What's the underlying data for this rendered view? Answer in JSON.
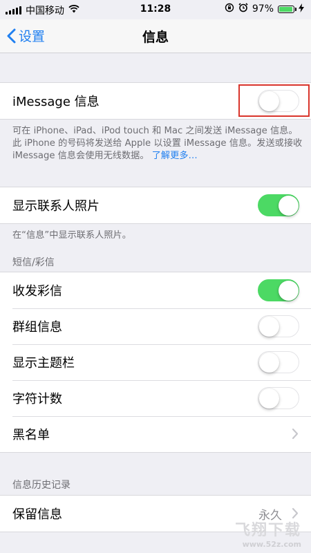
{
  "status_bar": {
    "carrier": "中国移动",
    "time": "11:28",
    "battery_percent": "97%",
    "battery_level": 0.97,
    "icons": [
      "signal-icon",
      "wifi-icon",
      "rotation-lock-icon",
      "alarm-icon",
      "battery-icon",
      "charging-icon"
    ]
  },
  "nav": {
    "back_label": "设置",
    "title": "信息"
  },
  "imessage": {
    "label": "iMessage 信息",
    "enabled": false
  },
  "imessage_footer": {
    "text": "可在 iPhone、iPad、iPod touch 和 Mac 之间发送 iMessage 信息。此 iPhone 的号码将发送给 Apple 以设置 iMessage 信息。发送或接收 iMessage 信息会使用无线数据。",
    "link": "了解更多…"
  },
  "contact_photos": {
    "label": "显示联系人照片",
    "enabled": true,
    "footer": "在“信息”中显示联系人照片。"
  },
  "sms_section": {
    "header": "短信/彩信",
    "rows": [
      {
        "label": "收发彩信",
        "enabled": true
      },
      {
        "label": "群组信息",
        "enabled": false
      },
      {
        "label": "显示主题栏",
        "enabled": false
      },
      {
        "label": "字符计数",
        "enabled": false
      }
    ],
    "blocked_label": "黑名单"
  },
  "history_section": {
    "header": "信息历史记录",
    "keep_label": "保留信息",
    "keep_value": "永久"
  },
  "watermark": {
    "title": "飞翔下载",
    "url": "www.52z.com"
  },
  "colors": {
    "accent": "#1f7ff0",
    "switch_on": "#4cd964",
    "highlight": "#d9342b",
    "background": "#efeff4"
  }
}
